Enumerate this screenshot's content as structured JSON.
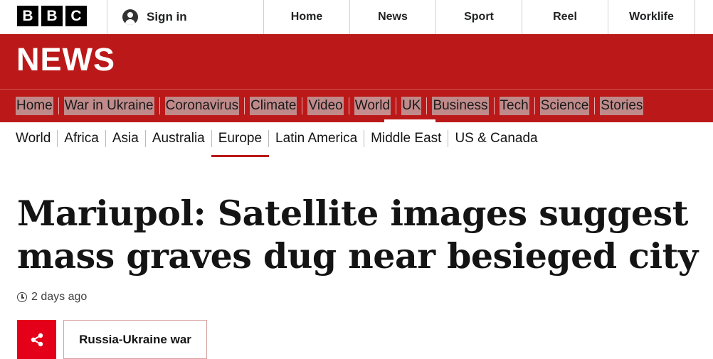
{
  "brand": {
    "letters": [
      "B",
      "B",
      "C"
    ]
  },
  "account": {
    "sign_in": "Sign in"
  },
  "top_nav": [
    "Home",
    "News",
    "Sport",
    "Reel",
    "Worklife"
  ],
  "banner": {
    "title": "NEWS"
  },
  "section_nav": {
    "items": [
      "Home",
      "War in Ukraine",
      "Coronavirus",
      "Climate",
      "Video",
      "World",
      "UK",
      "Business",
      "Tech",
      "Science",
      "Stories"
    ],
    "active": "World"
  },
  "sub_nav": {
    "items": [
      "World",
      "Africa",
      "Asia",
      "Australia",
      "Europe",
      "Latin America",
      "Middle East",
      "US & Canada"
    ],
    "active": "Europe"
  },
  "article": {
    "headline": "Mariupol: Satellite images suggest mass graves dug near besieged city",
    "timestamp": "2 days ago",
    "topic_tag": "Russia-Ukraine war"
  },
  "colors": {
    "brand_red": "#bb1919",
    "share_red": "#e5001a"
  },
  "icons": {
    "account": "user-icon",
    "time": "clock-icon",
    "share": "share-icon"
  }
}
